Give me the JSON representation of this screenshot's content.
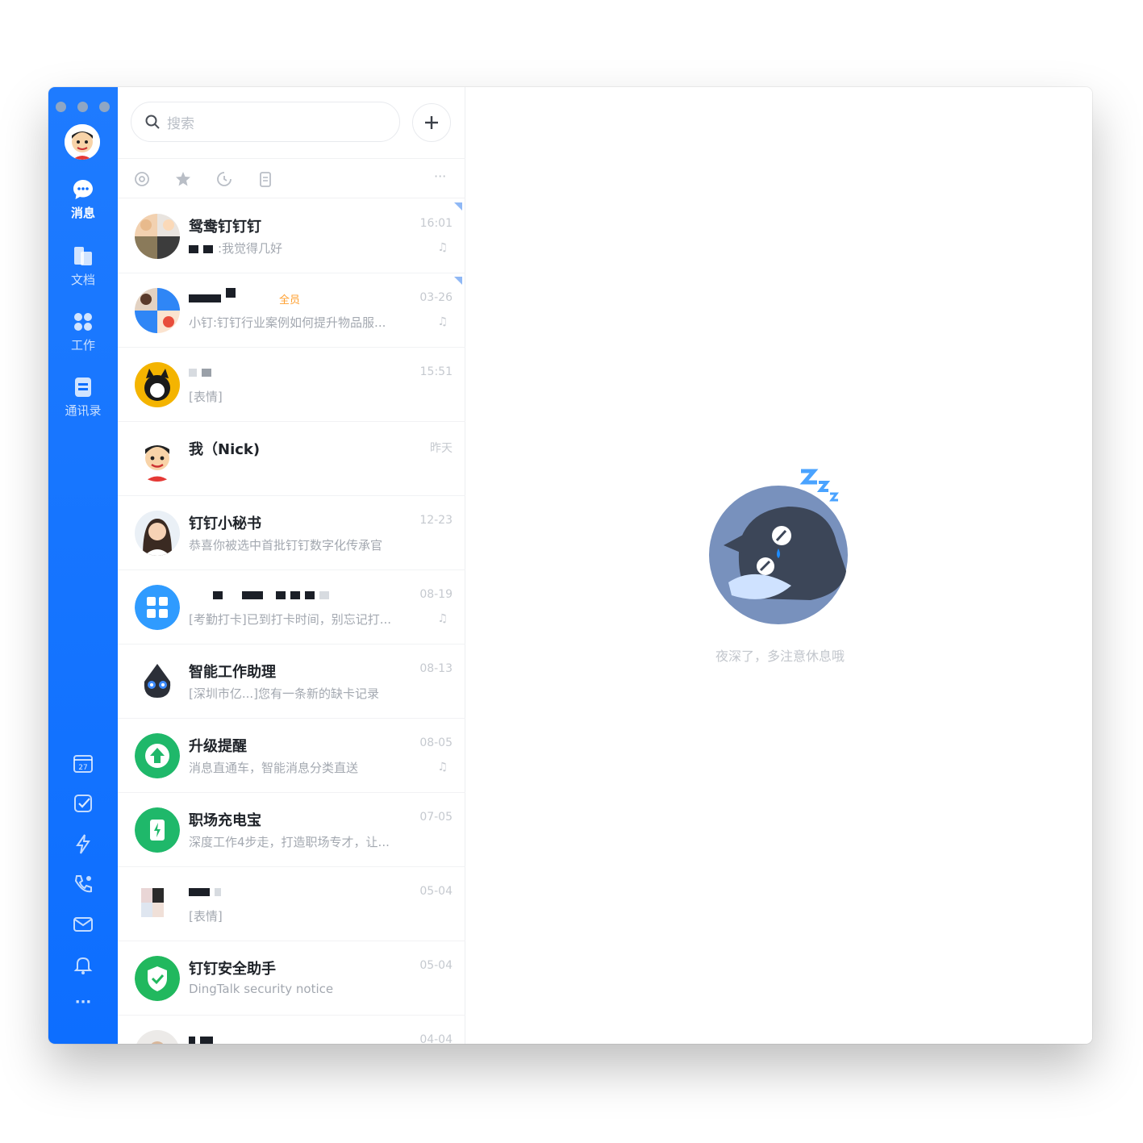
{
  "rail": {
    "nav": [
      {
        "label": "消息",
        "icon": "chat-bubble-icon",
        "active": true
      },
      {
        "label": "文档",
        "icon": "documents-icon",
        "active": false
      },
      {
        "label": "工作",
        "icon": "workbench-grid-icon",
        "active": false
      },
      {
        "label": "通讯录",
        "icon": "contacts-book-icon",
        "active": false
      }
    ],
    "calendar_day": "27",
    "tools": [
      "calendar-icon",
      "todo-check-icon",
      "ding-lightning-icon",
      "phone-call-icon",
      "mail-icon",
      "notification-icon",
      "more-icon"
    ],
    "more_label": "···"
  },
  "search": {
    "placeholder": "搜索"
  },
  "filters": {
    "more_label": "···"
  },
  "chats": [
    {
      "name": "鸳鸯钉钉钉",
      "preview": ":我觉得几好",
      "time": "16:01",
      "muted": true,
      "pinned": true
    },
    {
      "name": "",
      "tag": "全员",
      "preview": "小钉:钉钉行业案例如何提升物品服...",
      "time": "03-26",
      "muted": true,
      "pinned": true
    },
    {
      "name": "",
      "preview": "[表情]",
      "time": "15:51",
      "muted": false
    },
    {
      "name": "我（Nick)",
      "preview": "",
      "time": "昨天",
      "muted": false
    },
    {
      "name": "钉钉小秘书",
      "preview": "恭喜你被选中首批钉钉数字化传承官",
      "time": "12-23",
      "muted": false
    },
    {
      "name": "",
      "preview": "[考勤打卡]已到打卡时间，别忘记打...",
      "time": "08-19",
      "muted": true
    },
    {
      "name": "智能工作助理",
      "preview": "[深圳市亿...]您有一条新的缺卡记录",
      "time": "08-13",
      "muted": false
    },
    {
      "name": "升级提醒",
      "preview": "消息直通车，智能消息分类直送",
      "time": "08-05",
      "muted": true
    },
    {
      "name": "职场充电宝",
      "preview": "深度工作4步走，打造职场专才，让...",
      "time": "07-05",
      "muted": false
    },
    {
      "name": "",
      "preview": "[表情]",
      "time": "05-04",
      "muted": false
    },
    {
      "name": "钉钉安全助手",
      "preview": "DingTalk security notice",
      "time": "05-04",
      "muted": false
    },
    {
      "name": "",
      "preview": "",
      "time": "04-04",
      "muted": false
    }
  ],
  "main": {
    "empty_text": "夜深了，多注意休息哦",
    "illustration": "sleeping-cat-illustration"
  },
  "colors": {
    "accent": "#1677ff",
    "rail": "#0d6eff",
    "green": "#1fb86a"
  }
}
